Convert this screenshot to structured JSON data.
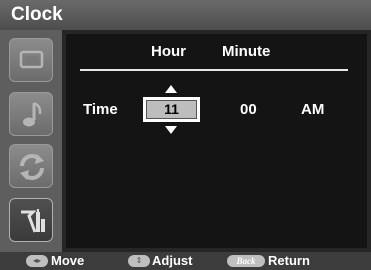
{
  "title": "Clock",
  "sidebar": {
    "items": [
      {
        "icon": "picture-icon",
        "active": false
      },
      {
        "icon": "music-note-icon",
        "active": false
      },
      {
        "icon": "refresh-arrows-icon",
        "active": false
      },
      {
        "icon": "tools-icon",
        "active": true
      }
    ]
  },
  "main": {
    "columns": {
      "hour": "Hour",
      "minute": "Minute"
    },
    "row": {
      "label": "Time",
      "hour": "11",
      "minute": "00",
      "ampm": "AM"
    }
  },
  "footer": {
    "move": "Move",
    "adjust": "Adjust",
    "back_key": "Back",
    "return": "Return"
  },
  "colors": {
    "background": "#141414",
    "title_bar": "#5a5a5a",
    "sidebar": "#5e5e5e",
    "selected_field": "#bdbdbd"
  }
}
